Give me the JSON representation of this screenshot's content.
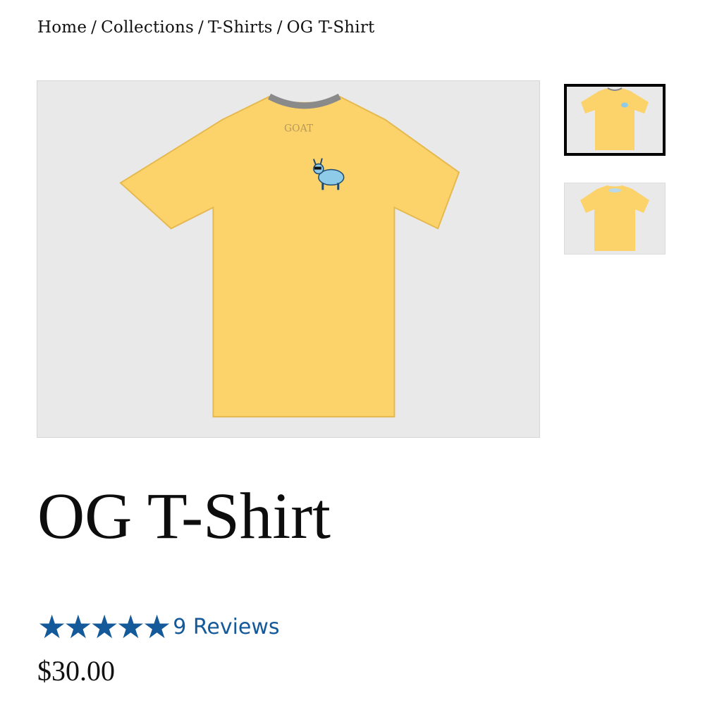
{
  "breadcrumb": {
    "items": [
      "Home",
      "Collections",
      "T-Shirts",
      "OG T-Shirt"
    ],
    "separator": "/"
  },
  "product": {
    "title": "OG T-Shirt",
    "price": "$30.00",
    "rating": {
      "stars": 5,
      "max": 5,
      "reviews_label": "9 Reviews"
    },
    "shirt_color": "#fcd36b",
    "collar_color": "#8a8a8a",
    "image_background": "#e9e9e9",
    "neck_label": "GOAT"
  },
  "gallery": {
    "thumbnails": [
      {
        "view": "front",
        "selected": true
      },
      {
        "view": "back",
        "selected": false
      }
    ]
  },
  "colors": {
    "accent": "#145a9a",
    "text": "#111111"
  }
}
